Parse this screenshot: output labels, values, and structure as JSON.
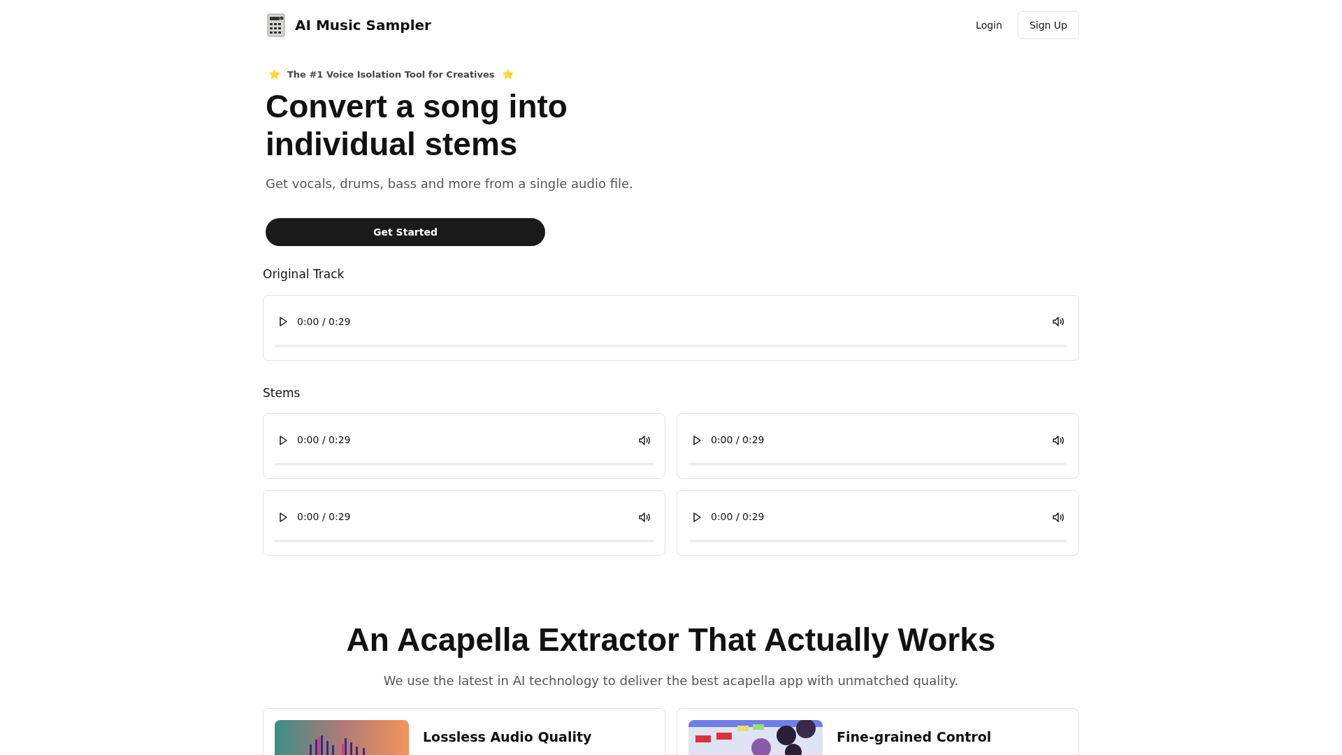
{
  "header": {
    "brand": "AI Music Sampler",
    "login": "Login",
    "signup": "Sign Up"
  },
  "hero": {
    "badge": "The #1 Voice Isolation Tool for Creatives",
    "badge_stars": "⭐",
    "title_lines": [
      "Convert a song into",
      "individual stems"
    ],
    "subtitle": "Get vocals, drums, bass and more from a single audio file.",
    "cta": "Get Started"
  },
  "original_track": {
    "label": "Original Track",
    "player": {
      "time": "0:00 / 0:29",
      "level": 0
    }
  },
  "stems": {
    "label": "Stems",
    "players": [
      {
        "time": "0:00 / 0:29",
        "level": 0
      },
      {
        "time": "0:00 / 0:29",
        "level": 0
      },
      {
        "time": "0:00 / 0:29",
        "level": 0
      },
      {
        "time": "0:00 / 0:29",
        "level": 0
      }
    ]
  },
  "features": {
    "title": "An Acapella Extractor That Actually Works",
    "subtitle": "We use the latest in AI technology to deliver the best acapella app with unmatched quality.",
    "cards": [
      {
        "title": "Lossless Audio Quality",
        "kind": "equalizer"
      },
      {
        "title": "Fine-grained Control",
        "kind": "mixer"
      }
    ]
  }
}
